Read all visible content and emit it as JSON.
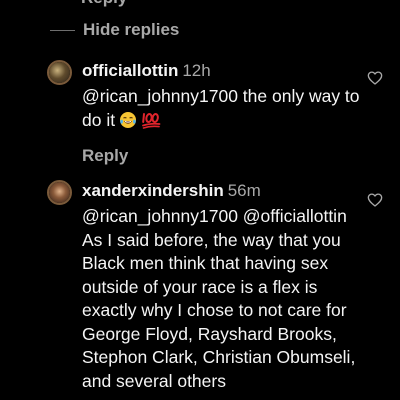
{
  "top_reply_label": "Reply",
  "hide_replies_label": "Hide replies",
  "comments": [
    {
      "username": "officiallottin",
      "time": "12h",
      "text": "@rican_johnny1700 the only way to do it",
      "emojis": [
        "laughing-tears-emoji",
        "hundred-points-emoji"
      ],
      "reply_label": "Reply"
    },
    {
      "username": "xanderxindershin",
      "time": "56m",
      "text": "@rican_johnny1700 @officiallottin As I said before, the way that you Black men think that having sex outside of your race is a flex is exactly why I chose to not care for George Floyd, Rayshard Brooks, Stephon Clark, Christian Obumseli, and several others"
    }
  ],
  "colors": {
    "background": "#000000",
    "primary_text": "#f5f5f5",
    "secondary_text": "#a8a8a8"
  },
  "icons": {
    "like": "heart-outline-icon"
  }
}
